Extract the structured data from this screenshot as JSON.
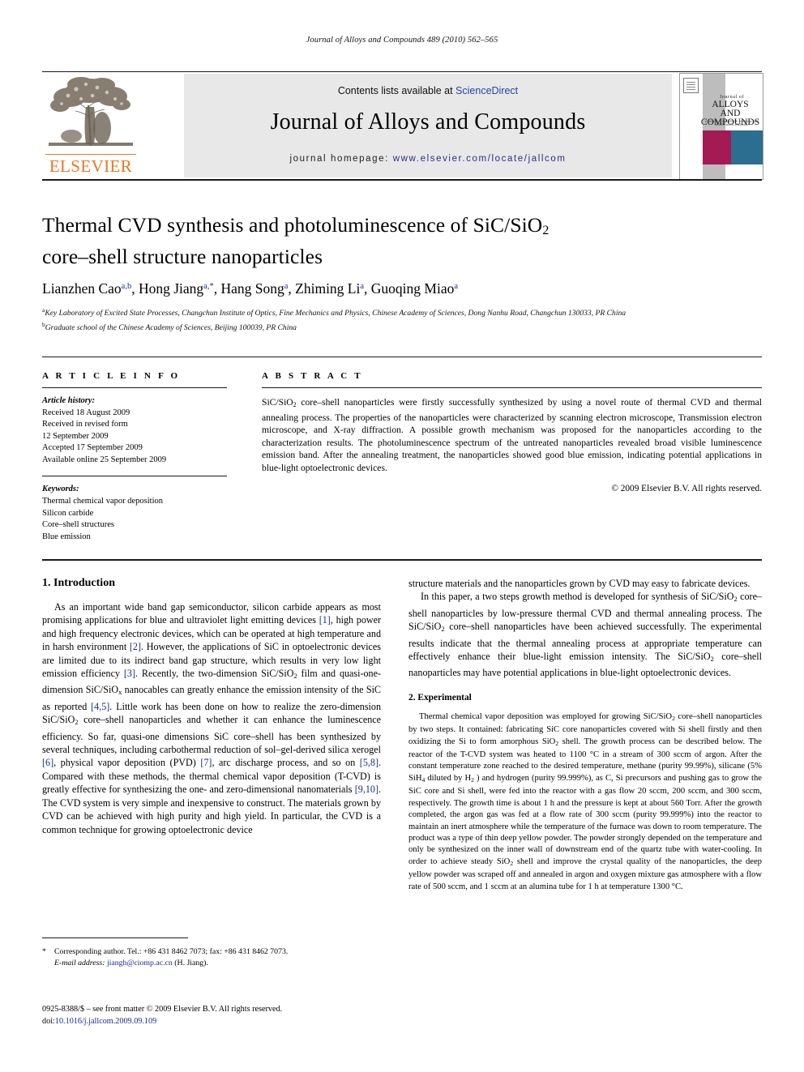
{
  "running_head": "Journal of Alloys and Compounds 489 (2010) 562–565",
  "masthead": {
    "contents_prefix": "Contents lists available at ",
    "sciencedirect": "ScienceDirect",
    "journal_title": "Journal of Alloys and Compounds",
    "homepage_prefix": "journal homepage:",
    "homepage_url": "www.elsevier.com/locate/jallcom",
    "publisher_logo_text": "ELSEVIER",
    "cover": {
      "line1": "Journal of",
      "line2": "ALLOYS",
      "line3": "AND COMPOUNDS",
      "subtitle": "A MATERIALS SCIENCE JOURNAL\nAND INTERFACES JOURNAL"
    },
    "colors": {
      "link": "#2b40a8",
      "elsevier_orange": "#E87722",
      "cover_magenta": "#a41a53",
      "cover_teal": "#2b6e8f",
      "band_gray": "#e8e8e8"
    }
  },
  "article": {
    "title_line1": "Thermal CVD synthesis and photoluminescence of SiC/SiO",
    "title_sub": "2",
    "title_line2": "core–shell structure nanoparticles",
    "authors": "Lianzhen Cao",
    "authors_full": [
      {
        "name": "Lianzhen Cao",
        "marks": "a,b",
        "sep": ", "
      },
      {
        "name": "Hong Jiang",
        "marks": "a,*",
        "sep": ", "
      },
      {
        "name": "Hang Song",
        "marks": "a",
        "sep": ", "
      },
      {
        "name": "Zhiming Li",
        "marks": "a",
        "sep": ", "
      },
      {
        "name": "Guoqing Miao",
        "marks": "a",
        "sep": ""
      }
    ],
    "affiliation_a_mark": "a",
    "affiliation_a": "Key Laboratory of Excited State Processes, Changchun Institute of Optics, Fine Mechanics and Physics, Chinese Academy of Sciences, Dong Nanhu Road, Changchun 130033, PR China",
    "affiliation_b_mark": "b",
    "affiliation_b": "Graduate school of the Chinese Academy of Sciences, Beijing 100039, PR China"
  },
  "article_info": {
    "heading": "A R T I C L E    I N F O",
    "history_label": "Article history:",
    "history": [
      "Received 18 August 2009",
      "Received in revised form",
      "12 September 2009",
      "Accepted 17 September 2009",
      "Available online 25 September 2009"
    ],
    "keywords_label": "Keywords:",
    "keywords": [
      "Thermal chemical vapor deposition",
      "Silicon carbide",
      "Core–shell structures",
      "Blue emission"
    ]
  },
  "abstract": {
    "heading": "A B S T R A C T",
    "part1": "SiC/SiO",
    "sub1": "2",
    "part2": " core–shell nanoparticles were firstly successfully synthesized by using a novel route of thermal CVD and thermal annealing process. The properties of the nanoparticles were characterized by scanning electron microscope, Transmission electron microscope, and X-ray diffraction. A possible growth mechanism was proposed for the nanoparticles according to the characterization results. The photoluminescence spectrum of the untreated nanoparticles revealed broad visible luminescence emission band. After the annealing treatment, the nanoparticles showed good blue emission, indicating potential applications in blue-light optoelectronic devices.",
    "copyright": "© 2009 Elsevier B.V. All rights reserved."
  },
  "sections": {
    "introduction": {
      "heading": "1.  Introduction",
      "p1_a": "As an important wide band gap semiconductor, silicon carbide appears as most promising applications for blue and ultraviolet light emitting devices ",
      "p1_r1": "[1]",
      "p1_b": ", high power and high frequency electronic devices, which can be operated at high temperature and in harsh environment ",
      "p1_r2": "[2]",
      "p1_c": ". However, the applications of SiC in optoelectronic devices are limited due to its indirect band gap structure, which results in very low light emission efficiency ",
      "p1_r3": "[3]",
      "p1_d": ". Recently, the two-dimension SiC/SiO",
      "p1_sub1": "2",
      "p1_e": " film and quasi-one-dimension SiC/SiO",
      "p1_subx": "x",
      "p1_f": " nanocables can greatly enhance the emission intensity of the SiC as reported ",
      "p1_r4": "[4,5]",
      "p1_g": ". Little work has been done on how to realize the zero-dimension SiC/SiO",
      "p1_sub2": "2",
      "p1_h": " core–shell nanoparticles and whether it can enhance the luminescence efficiency. So far, quasi-one dimensions SiC core–shell has been synthesized by several techniques, including carbothermal reduction of sol–gel-derived silica xerogel ",
      "p1_r5": "[6]",
      "p1_i": ", physical vapor deposition (PVD) ",
      "p1_r6": "[7]",
      "p1_j": ", arc discharge process, and so on ",
      "p1_r7": "[5,8]",
      "p1_k": ". Compared with these methods, the thermal chemical vapor deposition (T-CVD) is greatly effective for synthesizing the one- and zero-dimensional nanomaterials ",
      "p1_r8": "[9,10]",
      "p1_l": ". The CVD system is very simple and inexpensive to construct. The materials grown by CVD can be achieved with high purity and high yield. In particular, the CVD is a common technique for growing optoelectronic device structure materials and the nanoparticles grown by CVD may easy to fabricate devices.",
      "p2_a": "In this paper, a two steps growth method is developed for synthesis of SiC/SiO",
      "p2_sub1": "2",
      "p2_b": " core–shell nanoparticles by low-pressure thermal CVD and thermal annealing process. The SiC/SiO",
      "p2_sub2": "2",
      "p2_c": " core–shell nanoparticles have been achieved successfully. The experimental results indicate that the thermal annealing process at appropriate temperature can effectively enhance their blue-light emission intensity. The SiC/SiO",
      "p2_sub3": "2",
      "p2_d": " core–shell nanoparticles may have potential applications in blue-light optoelectronic devices."
    },
    "experimental": {
      "heading": "2.  Experimental",
      "p1_a": "Thermal chemical vapor deposition was employed for growing SiC/SiO",
      "p1_sub1": "2",
      "p1_b": " core–shell nanoparticles by two steps. It contained: fabricating SiC core nanoparticles covered with Si shell firstly and then oxidizing the Si to form amorphous SiO",
      "p1_sub2": "2",
      "p1_c": " shell. The growth process can be described below. The reactor of the T-CVD system was heated to 1100 °C in a stream of 300 sccm of argon. After the constant temperature zone reached to the desired temperature, methane (purity 99.99%), silicane (5% SiH",
      "p1_sub3": "4",
      "p1_d": " diluted by H",
      "p1_sub4": "2",
      "p1_e": " ) and hydrogen (purity 99.999%), as C, Si precursors and pushing gas to grow the SiC core and Si shell, were fed into the reactor with a gas flow 20 sccm, 200 sccm, and 300 sccm, respectively. The growth time is about 1 h and the pressure is kept at about 560 Torr. After the growth completed, the argon gas was fed at a flow rate of 300 sccm (purity 99.999%) into the reactor to maintain an inert atmosphere while the temperature of the furnace was down to room temperature. The product was a type of thin deep yellow powder. The powder strongly depended on the temperature and only be synthesized on the inner wall of downstream end of the quartz tube with water-cooling. In order to achieve steady SiO",
      "p1_sub5": "2",
      "p1_f": " shell and improve the crystal quality of the nanoparticles, the deep yellow powder was scraped off and annealed in argon and oxygen mixture gas atmosphere with a flow rate of 500 sccm, and 1 sccm at an alumina tube for 1 h at temperature 1300 °C."
    }
  },
  "footnote": {
    "star": "*",
    "corresponding": "Corresponding author. Tel.: +86 431 8462 7073; fax: +86 431 8462 7073.",
    "email_label": "E-mail address:",
    "email": "jiangh@ciomp.ac.cn",
    "email_suffix": " (H. Jiang)."
  },
  "imprint": {
    "line1": "0925-8388/$ – see front matter © 2009 Elsevier B.V. All rights reserved.",
    "doi_label": "doi:",
    "doi": "10.1016/j.jallcom.2009.09.109"
  }
}
